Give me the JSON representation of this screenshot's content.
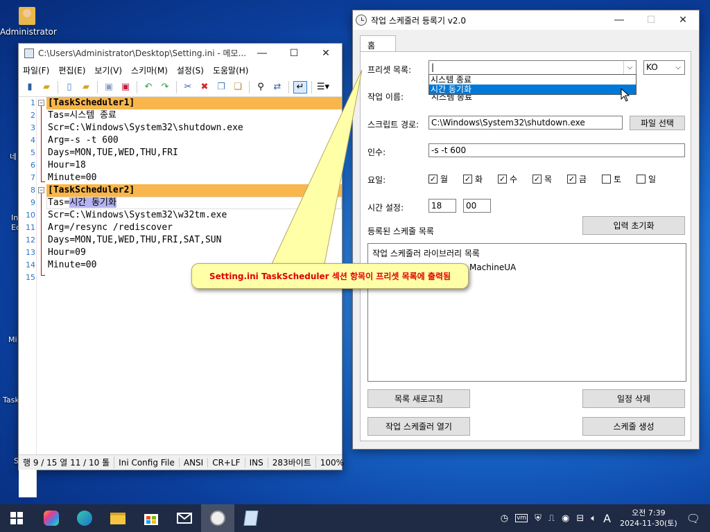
{
  "desktop": {
    "admin_label": "Administrator",
    "frag_1": "네",
    "frag_2": "In",
    "frag_3": "Ed",
    "frag_4": "Mi",
    "frag_5": "Task",
    "frag_6": "S"
  },
  "notepad": {
    "title": "C:\\Users\\Administrator\\Desktop\\Setting.ini - 메모...",
    "menu": [
      "파일(F)",
      "편집(E)",
      "보기(V)",
      "스키마(M)",
      "설정(S)",
      "도움말(H)"
    ],
    "lines": [
      {
        "n": "1",
        "text": "[TaskScheduler1]"
      },
      {
        "n": "2",
        "text": "Tas=시스템 종료"
      },
      {
        "n": "3",
        "text": "Scr=C:\\Windows\\System32\\shutdown.exe"
      },
      {
        "n": "4",
        "text": "Arg=-s -t 600"
      },
      {
        "n": "5",
        "text": "Days=MON,TUE,WED,THU,FRI"
      },
      {
        "n": "6",
        "text": "Hour=18"
      },
      {
        "n": "7",
        "text": "Minute=00"
      },
      {
        "n": "8",
        "text": "[TaskScheduler2]"
      },
      {
        "n": "9",
        "text_key": "Tas=",
        "text_sel": "시간 동기화"
      },
      {
        "n": "10",
        "text": "Scr=C:\\Windows\\System32\\w32tm.exe"
      },
      {
        "n": "11",
        "text": "Arg=/resync /rediscover"
      },
      {
        "n": "12",
        "text": "Days=MON,TUE,WED,THU,FRI,SAT,SUN"
      },
      {
        "n": "13",
        "text": "Hour=09"
      },
      {
        "n": "14",
        "text": "Minute=00"
      },
      {
        "n": "15",
        "text": ""
      }
    ],
    "status": {
      "position": "행 9 / 15  열 11 / 10  톨",
      "schema": "Ini Config File",
      "encoding": "ANSI",
      "eol": "CR+LF",
      "mode": "INS",
      "size": "283바이트",
      "zoom": "100%"
    }
  },
  "callout": {
    "text": "Setting.ini TaskScheduler 섹션 항목이 프리셋 목록에 출력됨"
  },
  "scheduler": {
    "title": "작업 스케줄러 등록기 v2.0",
    "tab_home": "홈",
    "preset_label": "프리셋 목록:",
    "preset_value": "|",
    "lang_value": "KO",
    "dropdown_items": [
      "시스템 종료",
      "시간 동기화"
    ],
    "overlap_text": "시스템 종료",
    "job_name_label": "작업 이름:",
    "script_label": "스크립트 경로:",
    "script_value": "C:\\Windows\\System32\\shutdown.exe",
    "file_button": "파일 선택",
    "args_label": "인수:",
    "args_value": "-s -t 600",
    "days_label": "요일:",
    "days": [
      {
        "label": "월",
        "checked": "✓"
      },
      {
        "label": "화",
        "checked": "✓"
      },
      {
        "label": "수",
        "checked": "✓"
      },
      {
        "label": "목",
        "checked": "✓"
      },
      {
        "label": "금",
        "checked": "✓"
      },
      {
        "label": "토",
        "checked": ""
      },
      {
        "label": "일",
        "checked": ""
      }
    ],
    "time_label": "시간 설정:",
    "hour_value": "18",
    "minute_value": "00",
    "reset_button": "입력 초기화",
    "registered_label": "등록된 스케줄 목록",
    "list_header": "작업 스케줄러 라이브러리 목록",
    "list_item_partial": "MachineUA",
    "refresh_button": "목록 새로고침",
    "delete_button": "일정 삭제",
    "open_button": "작업 스케줄러 열기",
    "create_button": "스케줄 생성"
  },
  "taskbar": {
    "time": "오전 7:39",
    "date": "2024-11-30(토)",
    "ime": "A"
  }
}
